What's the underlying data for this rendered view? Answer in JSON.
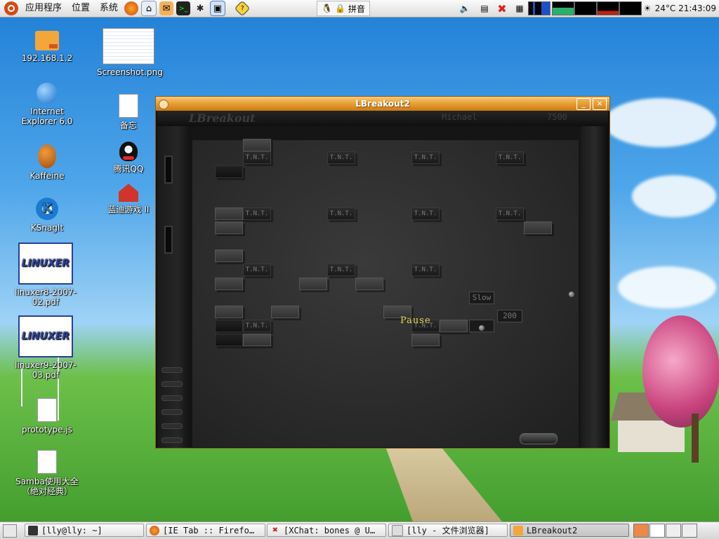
{
  "top_panel": {
    "menus": [
      "应用程序",
      "位置",
      "系统"
    ],
    "launchers": [
      "firefox-icon",
      "network-icon",
      "mail-icon",
      "terminal-icon",
      "spider-icon",
      "screen-icon",
      "help-icon"
    ],
    "ime": {
      "label": "拼音"
    },
    "weather": "24°C",
    "clock": "21:43:09"
  },
  "desktop_icons": {
    "col1": [
      {
        "label": "192.168.1.2",
        "icon": "folder-icon"
      },
      {
        "label": "Internet\nExplorer 6.0",
        "icon": "globe-icon"
      },
      {
        "label": "Kaffeine",
        "icon": "kaffeine-icon"
      },
      {
        "label": "KSnagIt",
        "icon": "ksnagit-icon"
      },
      {
        "label": "linuxer8-2007-\n02.pdf",
        "icon": "pdf-icon"
      },
      {
        "label": "linuxer9-2007-\n03.pdf",
        "icon": "pdf-icon"
      },
      {
        "label": "prototype.js",
        "icon": "document-icon"
      },
      {
        "label": "Samba使用大全\n（绝对经典）",
        "icon": "document-icon"
      }
    ],
    "col2": [
      {
        "label": "Screenshot.png",
        "icon": "image-icon"
      },
      {
        "label": "备忘",
        "icon": "document-icon"
      },
      {
        "label": "腾讯QQ",
        "icon": "qq-icon"
      },
      {
        "label": "蓝迪游戏 II",
        "icon": "game-icon"
      }
    ],
    "pdf_brand": "LINUXER"
  },
  "window": {
    "title": "LBreakout2",
    "minimize_label": "_",
    "close_label": "×"
  },
  "game": {
    "logo": "LBreakout",
    "player": "Michael",
    "score": "7500",
    "pause_text": "Pause",
    "brick_label": "T.N.T.",
    "bonus_slow": "Slow",
    "bonus_200": "200"
  },
  "taskbar": {
    "tasks": [
      {
        "label": "[lly@lly: ~]",
        "icon": "terminal-icon"
      },
      {
        "label": "[IE Tab :: Firefo…",
        "icon": "firefox-icon"
      },
      {
        "label": "[XChat: bones @ U…",
        "icon": "xchat-icon"
      },
      {
        "label": "[lly - 文件浏览器]",
        "icon": "file-browser-icon"
      },
      {
        "label": "LBreakout2",
        "icon": "lbreakout-icon"
      }
    ]
  }
}
